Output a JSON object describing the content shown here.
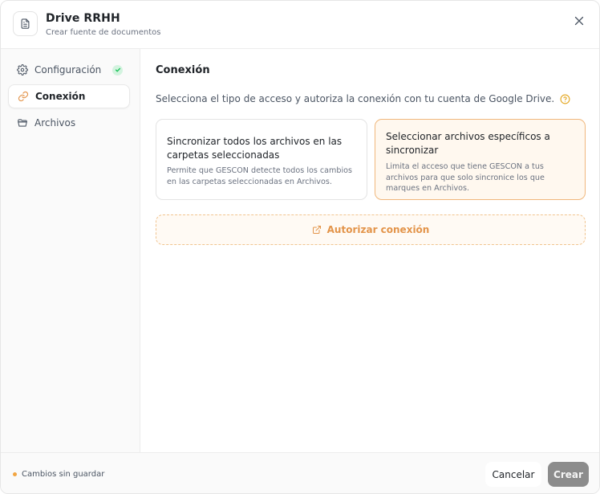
{
  "header": {
    "title": "Drive RRHH",
    "subtitle": "Crear fuente de documentos",
    "icon": "document-icon"
  },
  "sidebar": {
    "items": [
      {
        "label": "Configuración",
        "icon": "gear-icon",
        "completed": true
      },
      {
        "label": "Conexión",
        "icon": "link-icon",
        "active": true
      },
      {
        "label": "Archivos",
        "icon": "folder-icon"
      }
    ]
  },
  "main": {
    "title": "Conexión",
    "description": "Selecciona el tipo de acceso y autoriza la conexión con tu cuenta de Google Drive.",
    "options": [
      {
        "title": "Sincronizar todos los archivos en las carpetas seleccionadas",
        "description": "Permite que GESCON detecte todos los cambios en las carpetas seleccionadas en Archivos.",
        "selected": false
      },
      {
        "title": "Seleccionar archivos específicos a sincronizar",
        "description": "Limita el acceso que tiene GESCON a tus archivos para que solo sincronice los que marques en Archivos.",
        "selected": true
      }
    ],
    "authorize_label": "Autorizar conexión"
  },
  "footer": {
    "unsaved_label": "Cambios sin guardar",
    "cancel_label": "Cancelar",
    "create_label": "Crear"
  },
  "colors": {
    "accent": "#e3944a",
    "accent_border": "#f0b77c",
    "selected_bg": "#fff8ef",
    "success": "#22c55e",
    "disabled_button": "#8c8c8c",
    "unsaved_dot": "#f2a541"
  }
}
